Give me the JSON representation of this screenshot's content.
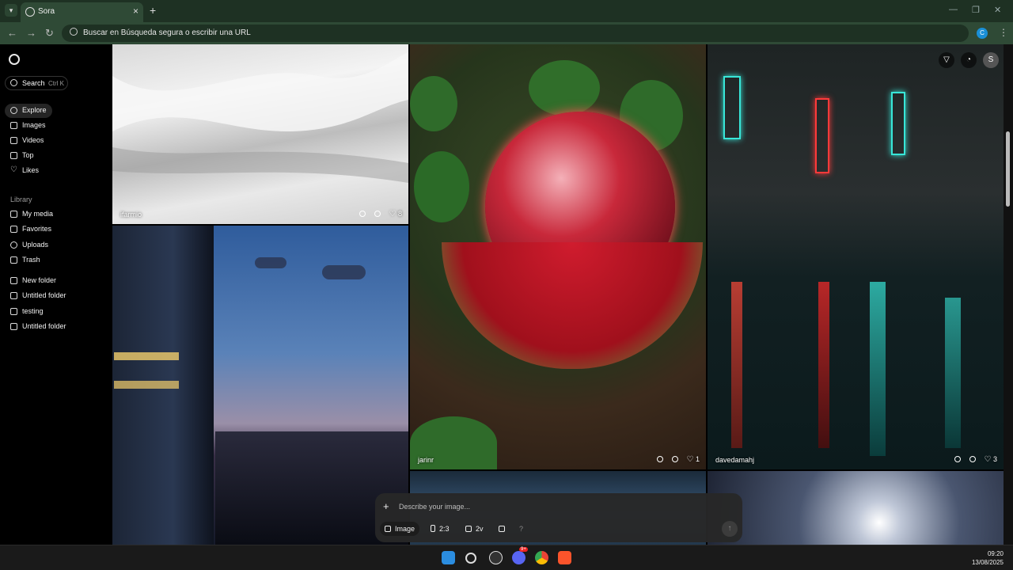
{
  "browser": {
    "tab_title": "Sora",
    "address_placeholder": "Buscar en Búsqueda segura o escribir una URL",
    "profile_initial": "C",
    "new_tab_glyph": "+",
    "close_glyph": "×"
  },
  "sidebar": {
    "search_label": "Search",
    "search_shortcut": "Ctrl K",
    "nav": [
      {
        "label": "Explore",
        "icon": "compass-icon",
        "active": true
      },
      {
        "label": "Images",
        "icon": "image-icon"
      },
      {
        "label": "Videos",
        "icon": "video-icon"
      },
      {
        "label": "Top",
        "icon": "trophy-icon"
      },
      {
        "label": "Likes",
        "icon": "heart-icon"
      }
    ],
    "library_label": "Library",
    "library": [
      {
        "label": "My media",
        "icon": "grid-icon"
      },
      {
        "label": "Favorites",
        "icon": "bookmark-icon"
      },
      {
        "label": "Uploads",
        "icon": "upload-icon"
      },
      {
        "label": "Trash",
        "icon": "trash-icon"
      }
    ],
    "folders": [
      {
        "label": "New folder",
        "icon": "folder-icon"
      },
      {
        "label": "Untitled folder",
        "icon": "folder-icon"
      },
      {
        "label": "testing",
        "icon": "folder-icon"
      },
      {
        "label": "Untitled folder",
        "icon": "folder-icon"
      }
    ]
  },
  "header_icons": {
    "profile_initial": "S"
  },
  "gallery": [
    {
      "user": "ifarmio",
      "likes": "8"
    },
    {
      "user": "jarinr",
      "likes": "1"
    },
    {
      "user": "davedamahj",
      "likes": "3"
    }
  ],
  "prompt": {
    "placeholder": "Describe your image...",
    "type_label": "Image",
    "aspect_label": "2:3",
    "variations_label": "2v",
    "help_glyph": "?"
  },
  "taskbar": {
    "time": "09:20",
    "date": "13/08/2025",
    "discord_badge": "9+"
  },
  "colors": {
    "tab_bar": "#1e3123",
    "toolbar": "#2f4a36",
    "sidebar_bg": "#000000",
    "prompt_bg": "#282828"
  }
}
